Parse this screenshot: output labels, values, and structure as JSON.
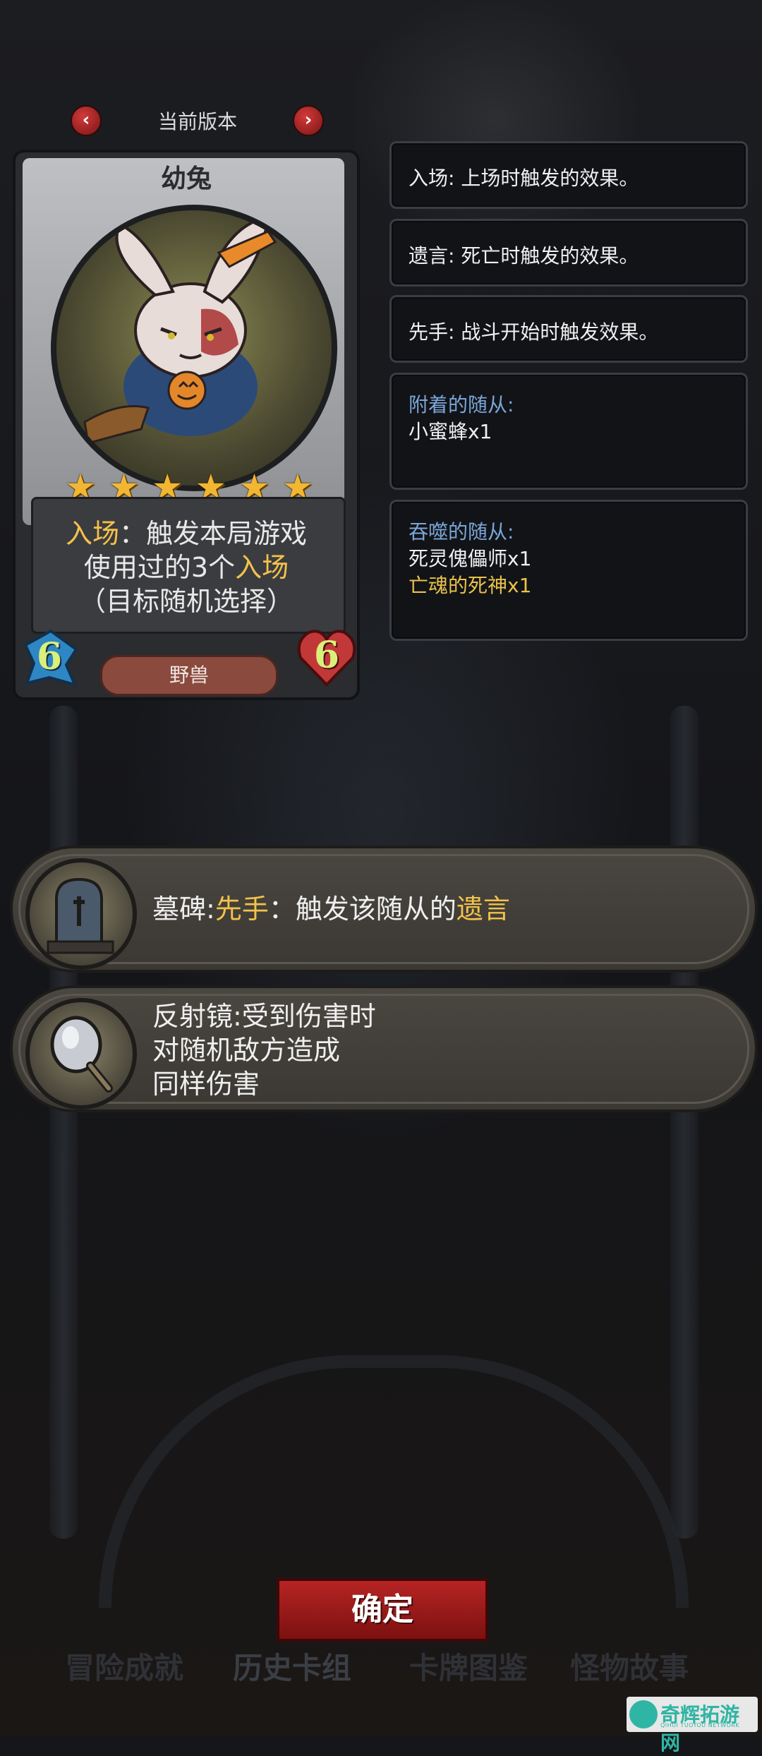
{
  "version": {
    "label": "当前版本",
    "prev": "‹",
    "next": "›"
  },
  "card": {
    "name": "幼兔",
    "stars": 6,
    "desc": {
      "kw1": "入场",
      "t1": "：触发本局游戏",
      "t2": "使用过的3个",
      "kw2": "入场",
      "t3": "（目标随机选择）"
    },
    "cost": "6",
    "hp": "6",
    "tribe": "野兽",
    "colors": {
      "keyword": "#f3c24a",
      "cost": "#3a9ee0",
      "hp": "#c73a3a"
    }
  },
  "info": {
    "entry": "入场: 上场时触发的效果。",
    "deathrattle": "遗言: 死亡时触发的效果。",
    "first": "先手: 战斗开始时触发效果。",
    "attached": {
      "heading": "附着的随从:",
      "items": [
        "小蜜蜂x1"
      ]
    },
    "devoured": {
      "heading": "吞噬的随从:",
      "items": [
        "死灵傀儡师x1",
        "亡魂的死神x1"
      ]
    }
  },
  "equipment": [
    {
      "icon": "tombstone-icon",
      "name": "墓碑:",
      "kw1": "先手",
      "mid": "：触发该随从的",
      "kw2": "遗言"
    },
    {
      "icon": "mirror-icon",
      "line1": "反射镜:受到伤害时",
      "line2": "对随机敌方造成",
      "line3": "同样伤害"
    }
  ],
  "confirm": "确定",
  "tabs": [
    "冒险成就",
    "历史卡组",
    "卡牌图鉴",
    "怪物故事"
  ],
  "watermark": {
    "title": "奇辉拓游网",
    "sub": "QIHUI TUOYOU NETWORK"
  }
}
